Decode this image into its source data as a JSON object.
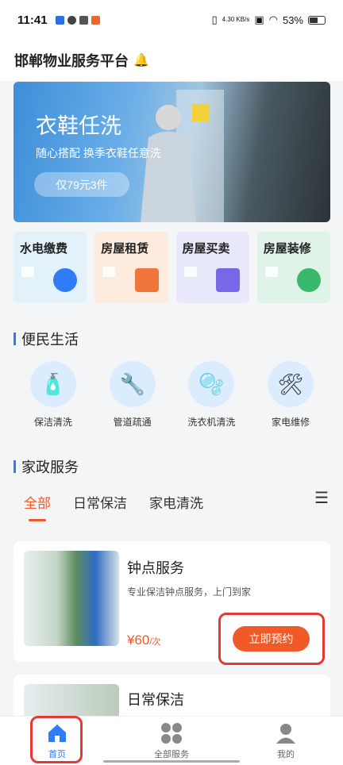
{
  "status_bar": {
    "time": "11:41",
    "net_speed": "4.30 KB/s",
    "battery": "53%"
  },
  "header": {
    "title": "邯郸物业服务平台",
    "bell_icon": "bell-icon"
  },
  "banner": {
    "title": "衣鞋任洗",
    "subtitle": "随心搭配 换季衣鞋任意洗",
    "price_pill": "仅79元3件"
  },
  "quick_cards": [
    {
      "label": "水电缴费",
      "bg": "#e3f1fb",
      "icon_color": "#2f7cf6",
      "icon": "water-electric-icon"
    },
    {
      "label": "房屋租赁",
      "bg": "#fdebdd",
      "icon_color": "#f0763c",
      "icon": "house-rent-icon"
    },
    {
      "label": "房屋买卖",
      "bg": "#e8e8fb",
      "icon_color": "#7768e8",
      "icon": "house-trade-icon"
    },
    {
      "label": "房屋装修",
      "bg": "#dff3e8",
      "icon_color": "#37b86b",
      "icon": "decoration-icon"
    }
  ],
  "section_convenience": {
    "title": "便民生活"
  },
  "convenience": [
    {
      "label": "保洁清洗",
      "icon": "cleaning-icon",
      "glyph": "🧴"
    },
    {
      "label": "管道疏通",
      "icon": "pipe-icon",
      "glyph": "🔧"
    },
    {
      "label": "洗衣机清洗",
      "icon": "washing-machine-icon",
      "glyph": "🫧"
    },
    {
      "label": "家电维修",
      "icon": "repair-tools-icon",
      "glyph": "🛠"
    }
  ],
  "section_housekeeping": {
    "title": "家政服务"
  },
  "tabs": [
    {
      "label": "全部"
    },
    {
      "label": "日常保洁"
    },
    {
      "label": "家电清洗"
    }
  ],
  "services": [
    {
      "title": "钟点服务",
      "desc": "专业保洁钟点服务，上门到家",
      "price": "¥60",
      "unit": "/次",
      "button": "立即预约"
    },
    {
      "title": "日常保洁"
    }
  ],
  "bottom_nav": [
    {
      "label": "首页"
    },
    {
      "label": "全部服务"
    },
    {
      "label": "我的"
    }
  ],
  "colors": {
    "accent": "#f05a28",
    "primary": "#2f7cf6",
    "highlight_box": "#e53935"
  }
}
